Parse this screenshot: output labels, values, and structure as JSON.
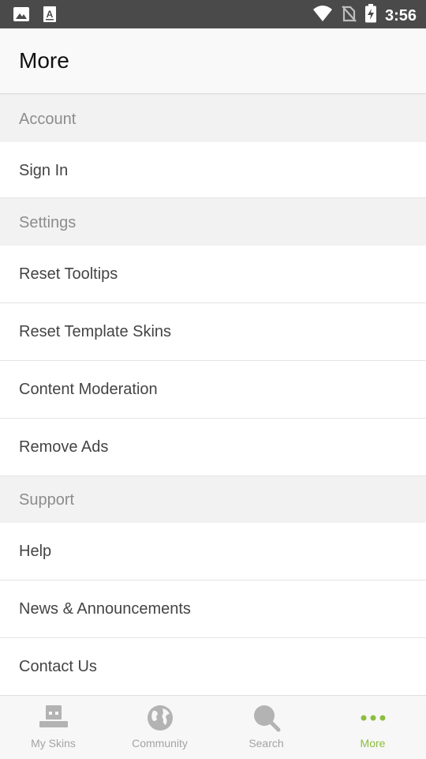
{
  "status_bar": {
    "time": "3:56",
    "icons": [
      "image-icon",
      "text-a-icon",
      "wifi-icon",
      "no-sim-icon",
      "battery-charging-icon"
    ]
  },
  "header": {
    "title": "More"
  },
  "sections": [
    {
      "title": "Account",
      "items": [
        {
          "label": "Sign In"
        }
      ]
    },
    {
      "title": "Settings",
      "items": [
        {
          "label": "Reset Tooltips"
        },
        {
          "label": "Reset Template Skins"
        },
        {
          "label": "Content Moderation"
        },
        {
          "label": "Remove Ads"
        }
      ]
    },
    {
      "title": "Support",
      "items": [
        {
          "label": "Help"
        },
        {
          "label": "News & Announcements"
        },
        {
          "label": "Contact Us"
        }
      ]
    }
  ],
  "bottom_nav": {
    "active": "More",
    "items": [
      {
        "label": "My Skins",
        "icon": "skin-icon"
      },
      {
        "label": "Community",
        "icon": "globe-icon"
      },
      {
        "label": "Search",
        "icon": "search-icon"
      },
      {
        "label": "More",
        "icon": "more-dots-icon"
      }
    ]
  },
  "colors": {
    "accent": "#8bbd3f",
    "status_bar": "#4a4a4a",
    "inactive_icon": "#b3b3b3"
  }
}
